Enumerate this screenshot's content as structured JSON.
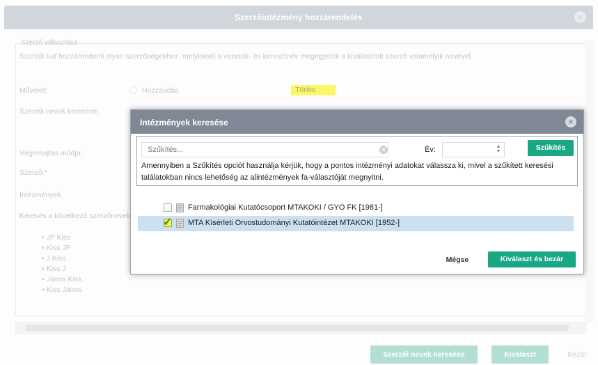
{
  "background_dialog": {
    "title": "Szerzőintézmény hozzárendelés",
    "fieldset_legend": "Szerző választása",
    "description": "Szerzőt tud hozzárendelni olyan szerzőségekhez, melyeknél a vezeték- és keresztnév megegyezik a kiválasztott szerző valamelyik nevével.",
    "muvelet_label": "Művelet:",
    "option_add": "Hozzáadás",
    "option_delete": "Törlés",
    "author_names_search_label": "Szerzői nevek keresése:",
    "mode_label": "Végrehajtás módja:",
    "author_label": "Szerző:*",
    "institutions_label": "Intézmények:",
    "search_names_label": "Keresés a következő szerzőnevekre:",
    "author_names": [
      "JP Kiss",
      "Kiss JP",
      "J Kiss",
      "Kiss J",
      "János Kiss",
      "Kiss János"
    ],
    "footer": {
      "search_names_button": "Szerzői nevek keresése",
      "execute_button": "Kiválaszt",
      "close_button": "Bezár"
    }
  },
  "modal": {
    "title": "Intézmények keresése",
    "search_placeholder": "Szűkítés...",
    "year_label": "Év:",
    "year_value": "",
    "filter_button": "Szűkítés",
    "info_text": "Amennyiben a Szűkítés opciót használja kérjük, hogy a pontos intézményi adatokat válassza ki, mivel a szűkített keresési találatokban nincs lehetőség az alintézmények fa-választóját megnyitni.",
    "tree_items": [
      {
        "label": "Farmakológiai Kutatócsoport MTAKOKI / GYO FK [1981-]",
        "checked": false,
        "selected": false
      },
      {
        "label": "MTA Kísérleti Orvostudományi Kutatóintézet MTAKOKI [1952-]",
        "checked": true,
        "selected": true
      }
    ],
    "cancel_button": "Mégse",
    "select_close_button": "Kiválaszt és bezár"
  },
  "colors": {
    "accent_teal": "#19a784",
    "modal_header": "#7f8894",
    "highlight_yellow": "#f5f53a",
    "selected_row": "#cbe1f2"
  },
  "icons": {
    "close": "close-icon",
    "clear": "clear-icon",
    "document": "document-icon",
    "checkmark": "checkmark-icon",
    "spinner": "spinner-icon"
  }
}
